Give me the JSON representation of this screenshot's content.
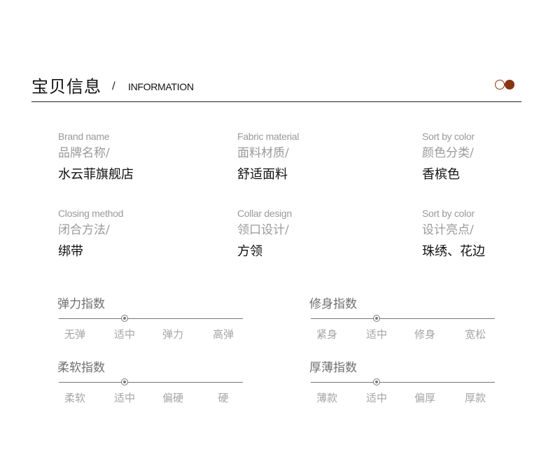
{
  "header": {
    "title": "宝贝信息",
    "slash": "/",
    "subtitle": "INFORMATION",
    "accent_color": "#8b3412"
  },
  "attributes": [
    {
      "en": "Brand name",
      "cn": "品牌名称/",
      "value": "水云菲旗舰店"
    },
    {
      "en": "Fabric material",
      "cn": "面料材质/",
      "value": "舒适面料"
    },
    {
      "en": "Sort by color",
      "cn": "颜色分类/",
      "value": "香槟色"
    },
    {
      "en": "Closing method",
      "cn": "闭合方法/",
      "value": "绑带"
    },
    {
      "en": "Collar design",
      "cn": "领口设计/",
      "value": "方领"
    },
    {
      "en": "Sort by color",
      "cn": "设计亮点/",
      "value": "珠绣、花边"
    }
  ],
  "scales": [
    {
      "title": "弹力指数",
      "labels": [
        "无弹",
        "适中",
        "弹力",
        "高弹"
      ],
      "selected": "适中"
    },
    {
      "title": "修身指数",
      "labels": [
        "紧身",
        "适中",
        "修身",
        "宽松"
      ],
      "selected": "适中"
    },
    {
      "title": "柔软指数",
      "labels": [
        "柔软",
        "适中",
        "偏硬",
        "硬"
      ],
      "selected": "适中"
    },
    {
      "title": "厚薄指数",
      "labels": [
        "薄款",
        "适中",
        "偏厚",
        "厚款"
      ],
      "selected": "适中"
    }
  ]
}
